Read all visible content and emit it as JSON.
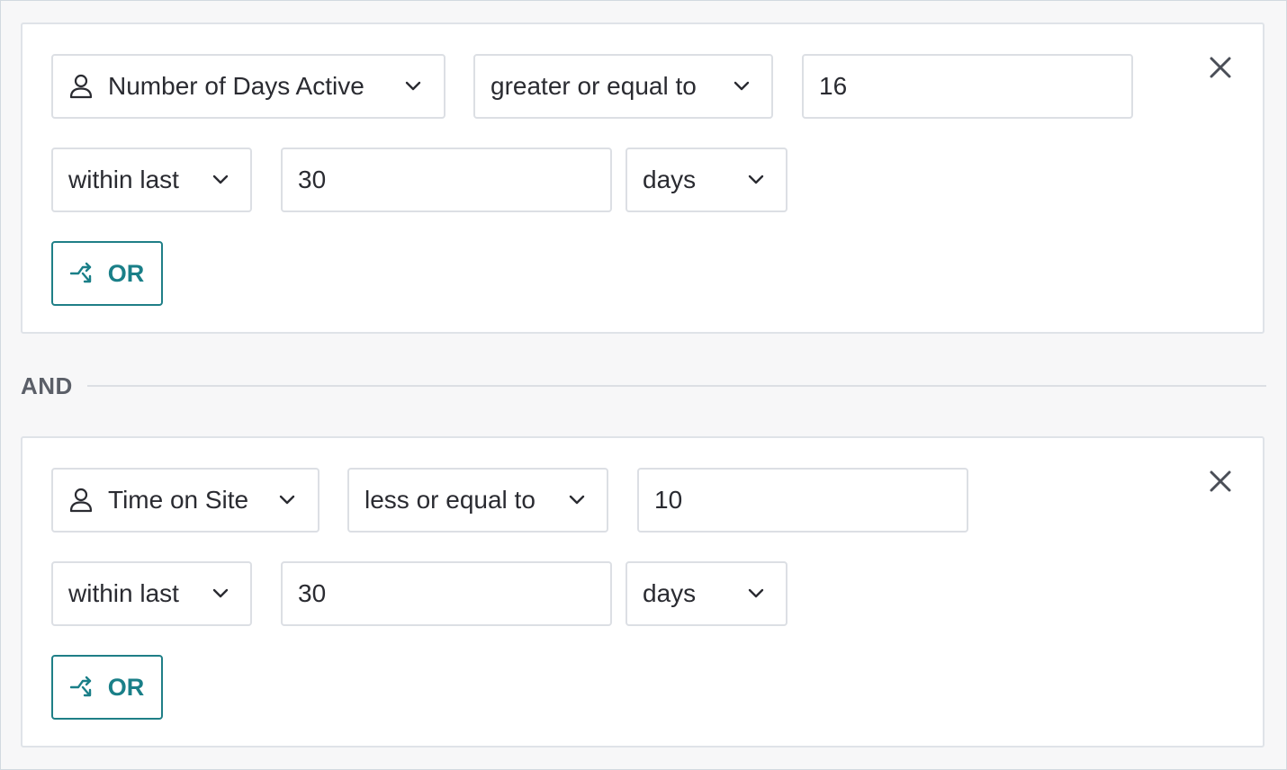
{
  "conditions": [
    {
      "property": "Number of Days Active",
      "operator": "greater or equal to",
      "value": "16",
      "timeframe": "within last",
      "period_value": "30",
      "period_unit": "days",
      "or_label": "OR",
      "icons": {
        "property": "person-icon",
        "remove": "close-icon",
        "or": "branch-icon",
        "dropdown": "chevron-down-icon"
      }
    },
    {
      "property": "Time on Site",
      "operator": "less or equal to",
      "value": "10",
      "timeframe": "within last",
      "period_value": "30",
      "period_unit": "days",
      "or_label": "OR",
      "icons": {
        "property": "person-icon",
        "remove": "close-icon",
        "or": "branch-icon",
        "dropdown": "chevron-down-icon"
      }
    }
  ],
  "joiner": "AND",
  "colors": {
    "accent": "#1a7f88",
    "border": "#dcdfe4",
    "background": "#f7f7f8",
    "text": "#2a2b31",
    "muted": "#5b5f68"
  }
}
